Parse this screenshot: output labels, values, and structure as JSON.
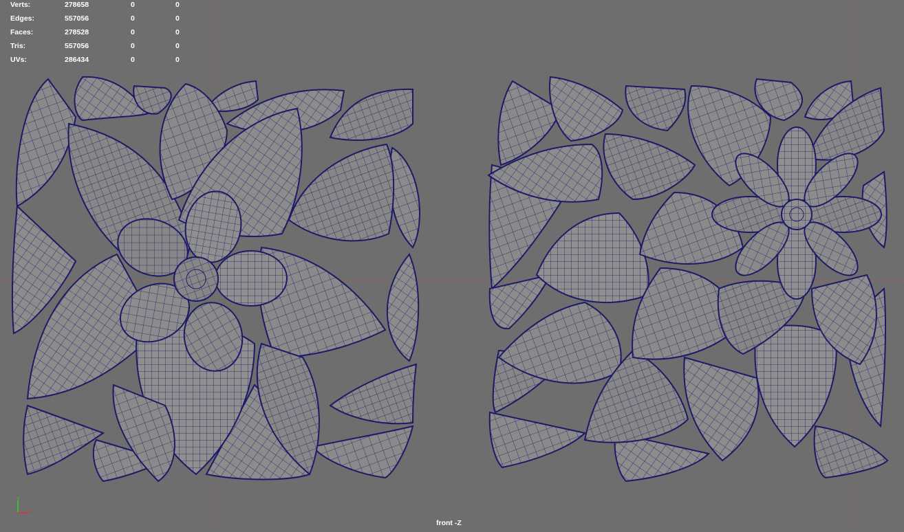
{
  "hud": {
    "rows": [
      {
        "label": "Verts:",
        "v1": "278658",
        "v2": "0",
        "v3": "0"
      },
      {
        "label": "Edges:",
        "v1": "557056",
        "v2": "0",
        "v3": "0"
      },
      {
        "label": "Faces:",
        "v1": "278528",
        "v2": "0",
        "v3": "0"
      },
      {
        "label": "Tris:",
        "v1": "557056",
        "v2": "0",
        "v3": "0"
      },
      {
        "label": "UVs:",
        "v1": "286434",
        "v2": "0",
        "v3": "0"
      }
    ]
  },
  "camera_label": "front -Z",
  "colors": {
    "background": "#6e6e6e",
    "mesh_fill": "#8a8a8a",
    "wireframe": "#1e1a66",
    "axis_x": "#e03030",
    "axis_y": "#30d030",
    "origin_line": "#b05a5a"
  }
}
